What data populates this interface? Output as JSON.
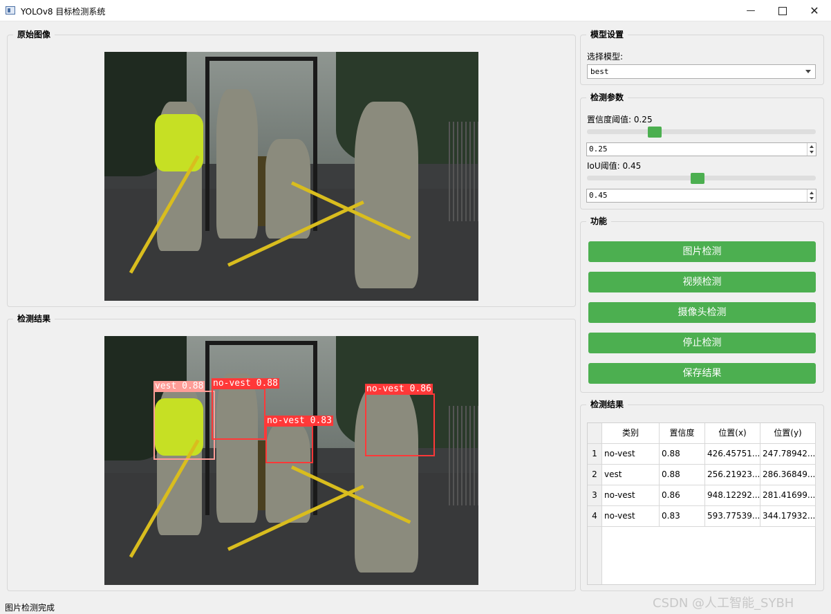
{
  "window": {
    "title": "YOLOv8 目标检测系统"
  },
  "groups": {
    "original": "原始图像",
    "result": "检测结果",
    "model_settings": "模型设置",
    "detect_params": "检测参数",
    "functions": "功能",
    "result_table": "检测结果"
  },
  "model": {
    "label": "选择模型:",
    "selected": "best"
  },
  "params": {
    "conf_label": "置信度阈值: 0.25",
    "conf_value": "0.25",
    "conf_level": 0.25,
    "iou_label": "IoU阈值: 0.45",
    "iou_value": "0.45",
    "iou_level": 0.45
  },
  "buttons": {
    "image_detect": "图片检测",
    "video_detect": "视频检测",
    "camera_detect": "摄像头检测",
    "stop_detect": "停止检测",
    "save_result": "保存结果"
  },
  "detections": [
    {
      "label": "vest 0.88"
    },
    {
      "label": "no-vest 0.88"
    },
    {
      "label": "no-vest 0.83"
    },
    {
      "label": "no-vest 0.86"
    }
  ],
  "table": {
    "headers": [
      "类别",
      "置信度",
      "位置(x)",
      "位置(y)"
    ],
    "rows": [
      {
        "num": "1",
        "cls": "no-vest",
        "conf": "0.88",
        "x": "426.45751...",
        "y": "247.78942..."
      },
      {
        "num": "2",
        "cls": "vest",
        "conf": "0.88",
        "x": "256.21923...",
        "y": "286.36849..."
      },
      {
        "num": "3",
        "cls": "no-vest",
        "conf": "0.86",
        "x": "948.12292...",
        "y": "281.41699..."
      },
      {
        "num": "4",
        "cls": "no-vest",
        "conf": "0.83",
        "x": "593.77539...",
        "y": "344.17932..."
      }
    ]
  },
  "status": "图片检测完成",
  "watermark": "CSDN @人工智能_SYBH"
}
